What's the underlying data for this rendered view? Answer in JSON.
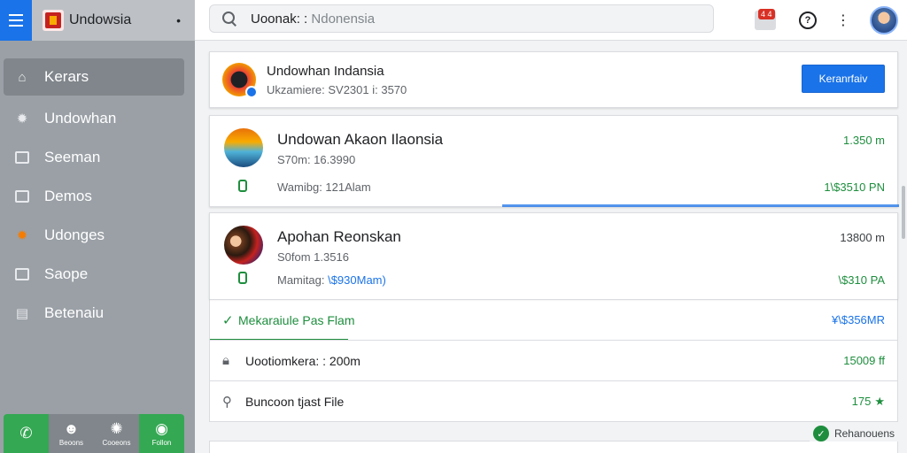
{
  "app": {
    "title": "Undowsia"
  },
  "search": {
    "label": "Uoonak: :",
    "value": "Ndonensia"
  },
  "notifications": {
    "count": "4 4"
  },
  "sidebar": {
    "items": [
      {
        "label": "Kerars",
        "icon": "home-icon"
      },
      {
        "label": "Undowhan",
        "icon": "gear-icon"
      },
      {
        "label": "Seeman",
        "icon": "square-icon"
      },
      {
        "label": "Demos",
        "icon": "window-icon"
      },
      {
        "label": "Udonges",
        "icon": "gear-icon-orange"
      },
      {
        "label": "Saope",
        "icon": "square-icon"
      },
      {
        "label": "Betenaiu",
        "icon": "grid-icon"
      }
    ],
    "bottom": [
      {
        "label": "",
        "icon": "phone-icon"
      },
      {
        "label": "Beoons",
        "icon": "people-icon"
      },
      {
        "label": "Cooeons",
        "icon": "gear-icon"
      },
      {
        "label": "Follon",
        "icon": "circle-icon"
      }
    ]
  },
  "header_card": {
    "name": "Undowhan Indansia",
    "subtitle": "Ukzamiere: SV2301 i: 3570",
    "button": "Keranrfaiv"
  },
  "items": [
    {
      "title": "Undowan Akaon Ilaonsia",
      "subtitle": "S70m: 16.3990",
      "meta_label": "Wamibg: 121Alam",
      "meta_value": "",
      "right_top": "1.350 m",
      "right_bottom": "1\\$3510 PN"
    },
    {
      "title": "Apohan Reonskan",
      "subtitle": "S0fom 1.3516",
      "meta_label": "Mamitag:",
      "meta_value": "\\$930Mam)",
      "right_top": "13800 m",
      "right_bottom": "\\$310 PA"
    }
  ],
  "rows": [
    {
      "icon": "check-icon",
      "label": "Mekaraiule Pas Flam",
      "value": "¥\\$356MR"
    },
    {
      "icon": "lock-icon",
      "label": "Uootiomkera: : 200m",
      "value": "15009 ff"
    },
    {
      "icon": "pin-icon",
      "label": "Buncoon tjast File",
      "value": "175"
    }
  ],
  "status": {
    "label": "Rehanouens"
  },
  "colors": {
    "accent": "#1a73e8",
    "success": "#1e8e3e",
    "sidebar": "#9aa0a6"
  }
}
